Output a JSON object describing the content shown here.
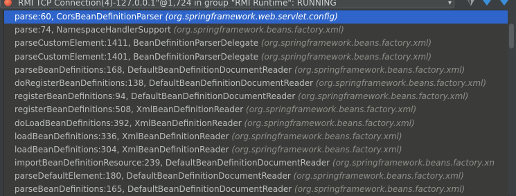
{
  "thread_selector": {
    "label": "RMI TCP Connection(4)-127.0.0.1\"@1,724 in group \"RMI Runtime\": RUNNING",
    "arrow_icon": "chevron-down-icon"
  },
  "toolbar": {
    "filter_icon": "filter-icon",
    "up_icon": "arrow-up-icon",
    "down_icon": "arrow-down-icon"
  },
  "frames": [
    {
      "method": "parse:60, CorsBeanDefinitionParser",
      "package": "(org.springframework.web.servlet.config)",
      "selected": true
    },
    {
      "method": "parse:74, NamespaceHandlerSupport",
      "package": "(org.springframework.beans.factory.xml)"
    },
    {
      "method": "parseCustomElement:1411, BeanDefinitionParserDelegate",
      "package": "(org.springframework.beans.factory.xml)"
    },
    {
      "method": "parseCustomElement:1401, BeanDefinitionParserDelegate",
      "package": "(org.springframework.beans.factory.xml)"
    },
    {
      "method": "parseBeanDefinitions:168, DefaultBeanDefinitionDocumentReader",
      "package": "(org.springframework.beans.factory.xml)"
    },
    {
      "method": "doRegisterBeanDefinitions:138, DefaultBeanDefinitionDocumentReader",
      "package": "(org.springframework.beans.factory.xml)"
    },
    {
      "method": "registerBeanDefinitions:94, DefaultBeanDefinitionDocumentReader",
      "package": "(org.springframework.beans.factory.xml)"
    },
    {
      "method": "registerBeanDefinitions:508, XmlBeanDefinitionReader",
      "package": "(org.springframework.beans.factory.xml)"
    },
    {
      "method": "doLoadBeanDefinitions:392, XmlBeanDefinitionReader",
      "package": "(org.springframework.beans.factory.xml)"
    },
    {
      "method": "loadBeanDefinitions:336, XmlBeanDefinitionReader",
      "package": "(org.springframework.beans.factory.xml)"
    },
    {
      "method": "loadBeanDefinitions:304, XmlBeanDefinitionReader",
      "package": "(org.springframework.beans.factory.xml)"
    },
    {
      "method": "importBeanDefinitionResource:239, DefaultBeanDefinitionDocumentReader",
      "package": "(org.springframework.beans.factory.xn"
    },
    {
      "method": "parseDefaultElement:180, DefaultBeanDefinitionDocumentReader",
      "package": "(org.springframework.beans.factory.xml)"
    },
    {
      "method": "parseBeanDefinitions:165, DefaultBeanDefinitionDocumentReader",
      "package": "(org.springframework.beans.factory.xml)"
    }
  ]
}
